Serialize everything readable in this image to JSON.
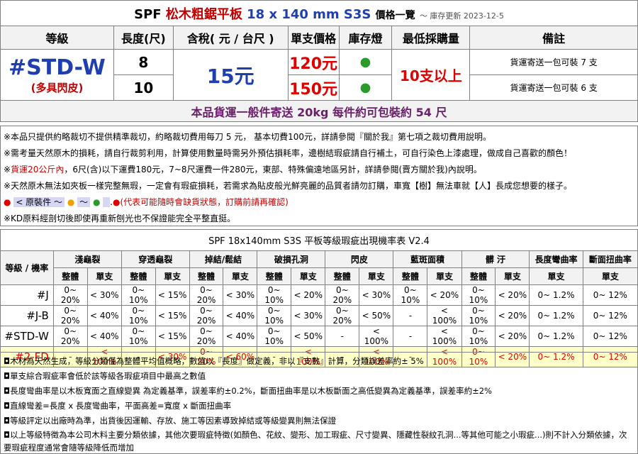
{
  "title": {
    "prefix": "SPF ",
    "name": "松木粗鋸平板",
    "size": " 18 x 140 mm S3S ",
    "suffix": "價格一覽",
    "update": "～ 庫存更新 2023-12-5"
  },
  "headers": [
    "等級",
    "長度(尺)",
    "含稅( 元 / 台尺 )",
    "單支價格",
    "庫存燈",
    "最低採購量",
    "備註"
  ],
  "grade": {
    "code": "#STD-W",
    "desc": "(多具閃皮)"
  },
  "price_per_unit": "15元",
  "min_order": "10支以上",
  "rows": [
    {
      "length": "8",
      "price": "120元",
      "stock": "●",
      "remark": "貨運寄送一包可裝 7 支"
    },
    {
      "length": "10",
      "price": "150元",
      "stock": "●",
      "remark": "貨運寄送一包可裝 6 支"
    }
  ],
  "shipping_note": "本品貨運一般件寄送 20kg 每件約可包裝約 54 尺",
  "notes": {
    "n1": "※本品只提供約略裁切不提供精準裁切，約略裁切費用每刀 5 元， 基本切費100元，詳請參閱『關於我』第七項之裁切費用說明。",
    "n2": "※需考量天然原木的損耗，請自行裁剪利用，計算使用數量時需另外預估損耗率，邊樹結瑕疵請自行補土，可自行染色上漆處理，做成自己喜歡的顏色！",
    "n3a": "※",
    "n3b": "貨運20公斤內",
    "n3c": "，6尺(含)以下運費180元，7~8尺運費一件280元，東部、特殊偏遠地區另計，詳請參閱(賣方關於我)內說明。",
    "n4": "※天然原木無法如夾板一樣完整無瑕，一定會有瑕疵損耗，若需求為貼皮般光鮮亮麗的品質者請勿訂購，車寬【樹】無法車就【人】長成您想要的樣子。",
    "n5a": "< 原裝件 ～",
    "n5b": "～",
    "n5c": "(代表可能隨時會缺貨狀態，訂購前請再確認)",
    "n6": "※KD原料經剖切後即使再重新刨光也不保證能完全平整直挺。"
  },
  "defect_table": {
    "title": "SPF 18x140mm S3S 平板等級瑕疵出現機率表 V2.4",
    "corner": "等級 / 機率",
    "categories": [
      "淺龜裂",
      "穿透龜裂",
      "掉結/鬆結",
      "破損孔洞",
      "閃皮",
      "藍斑面積",
      "髒 汙",
      "長度彎曲率",
      "斷面扭曲率"
    ],
    "sub_full": "整體",
    "sub_single": "單支",
    "rows": [
      {
        "grade": "#J",
        "values": [
          "0~ 20%",
          "< 30%",
          "0~ 10%",
          "< 15%",
          "0~ 20%",
          "< 30%",
          "0~ 10%",
          "< 20%",
          "0~ 20%",
          "< 30%",
          "0~ 10%",
          "< 20%",
          "0~ 10%",
          "< 20%",
          "0~ 1.2%",
          "0~ 12%"
        ]
      },
      {
        "grade": "#J-B",
        "values": [
          "0~ 20%",
          "< 40%",
          "0~ 10%",
          "< 15%",
          "0~ 20%",
          "< 40%",
          "0~ 10%",
          "< 30%",
          "0~ 20%",
          "< 50%",
          "-",
          "< 100%",
          "0~ 10%",
          "< 20%",
          "0~ 1.2%",
          "0~ 12%"
        ]
      },
      {
        "grade": "#STD-W",
        "values": [
          "0~ 20%",
          "< 40%",
          "0~ 10%",
          "< 15%",
          "0~ 20%",
          "< 40%",
          "0~ 10%",
          "< 50%",
          "-",
          "< 100%",
          "-",
          "< 100%",
          "0~ 10%",
          "< 20%",
          "0~ 1.2%",
          "0~ 12%"
        ]
      },
      {
        "grade": "#2-FD",
        "values": [
          "-",
          "< 100%",
          "-",
          "< 30%",
          "0~ 20%",
          "< 60%",
          "-",
          "< 100%",
          "-",
          "< 100%",
          "-",
          "< 100%",
          "0~ 10%",
          "< 20%",
          "0~ 1.2%",
          "0~ 12%"
        ]
      }
    ]
  },
  "footnotes": [
    "◘木材為天然生成，等級分類僅為整體平均值概略，數值以『長度』做定義，非以『支數』計算，分類誤差率約± 5%",
    "◘單支綜合瑕疵率會低於該等級各瑕疵項目中最高之數值",
    "◘長度彎曲率是以木板寬面之直線變異 為定義基準，誤差率約±0.2%，斷面扭曲率是以木板斷面之高低變異為定義基準，誤差率約±2%",
    "◘直線彎差=長度 x 長度彎曲率，平面高差=寬度 x 斷面扭曲率",
    "◘等級評定以出廠時為準，出貨後因運輸、存放、施工等因素導致掉結或等級變異則無法保證",
    "◘以上等級特徵為本公司木料主要分類依據，其他次要瑕疵特徵(如顏色、花紋、變形、加工瑕疵、尺寸變異、隱藏性裂紋孔洞...等其他可能之小瑕疵...)則不計入分類依據，次要瑕疵程度通常會隨等級降低而增加"
  ],
  "colors": {
    "blue": "#1f3fae",
    "red": "#e00000",
    "green": "#2a9a2a",
    "purple": "#6a1f6a",
    "highlight": "#ffffc8"
  }
}
